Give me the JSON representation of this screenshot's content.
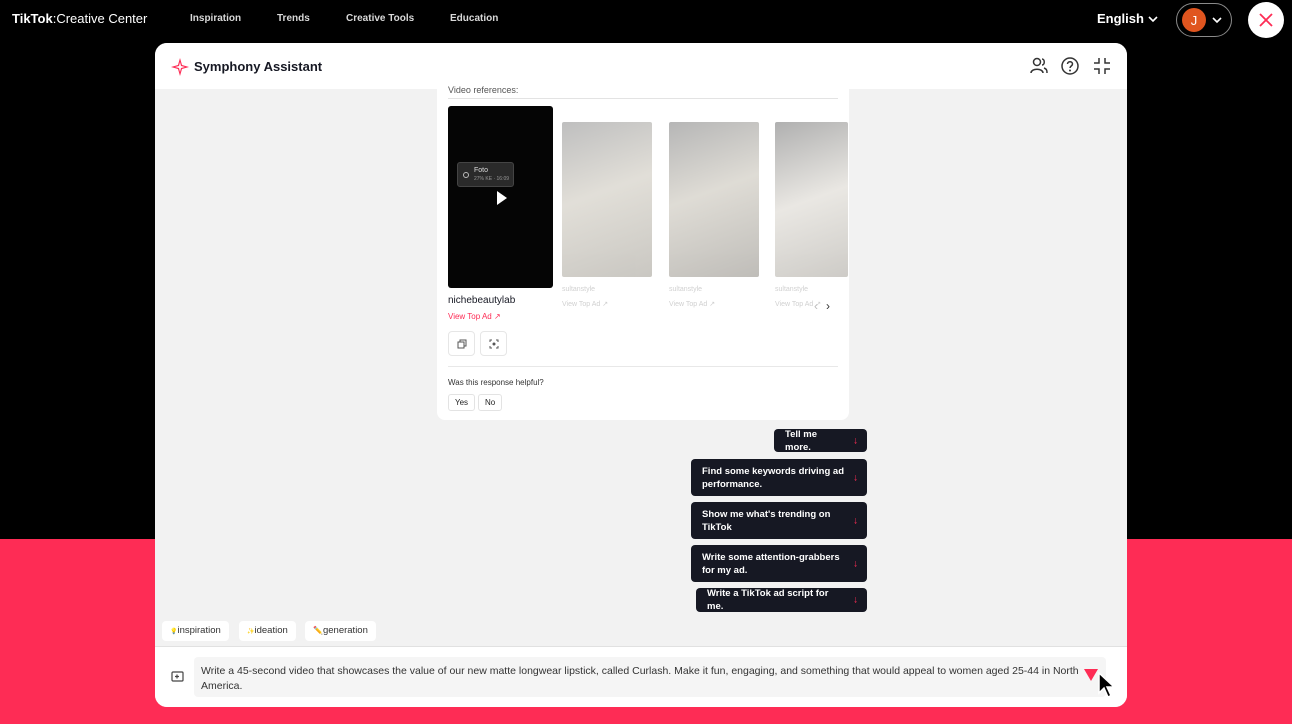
{
  "topnav": {
    "logo_brand": "TikTok",
    "logo_sub": ":Creative Center",
    "items": [
      "Inspiration",
      "Trends",
      "Creative Tools",
      "Education"
    ],
    "language": "English",
    "avatar_initial": "J"
  },
  "panel": {
    "title": "Symphony Assistant"
  },
  "card": {
    "subheading": "Video references:",
    "foto_label": "Foto",
    "foto_sub": "27% KE · 16:09",
    "creator": "nichebeautylab",
    "view_top_ad": "View Top Ad ↗",
    "ghost_creator": "sultanstyle",
    "ghost_link": "View Top Ad ↗",
    "helpful_question": "Was this response helpful?",
    "yes": "Yes",
    "no": "No"
  },
  "suggestions": [
    "Tell me more.",
    "Find some keywords driving ad performance.",
    "Show me what's trending on TikTok",
    "Write some attention-grabbers for my ad.",
    "Write a TikTok ad script for me."
  ],
  "suggestion_arrow": "↓",
  "tags": [
    "inspiration",
    "ideation",
    "generation"
  ],
  "tag_icons": [
    "💡",
    "✨",
    "✏️"
  ],
  "input": {
    "prompt": "Write a 45-second video that showcases the value of our new matte longwear lipstick, called Curlash. Make it fun, engaging, and something that would appeal to women aged 25-44 in North America."
  },
  "colors": {
    "accent": "#fe2c55",
    "dark": "#161823",
    "panel_bg": "#f2f2f2"
  }
}
